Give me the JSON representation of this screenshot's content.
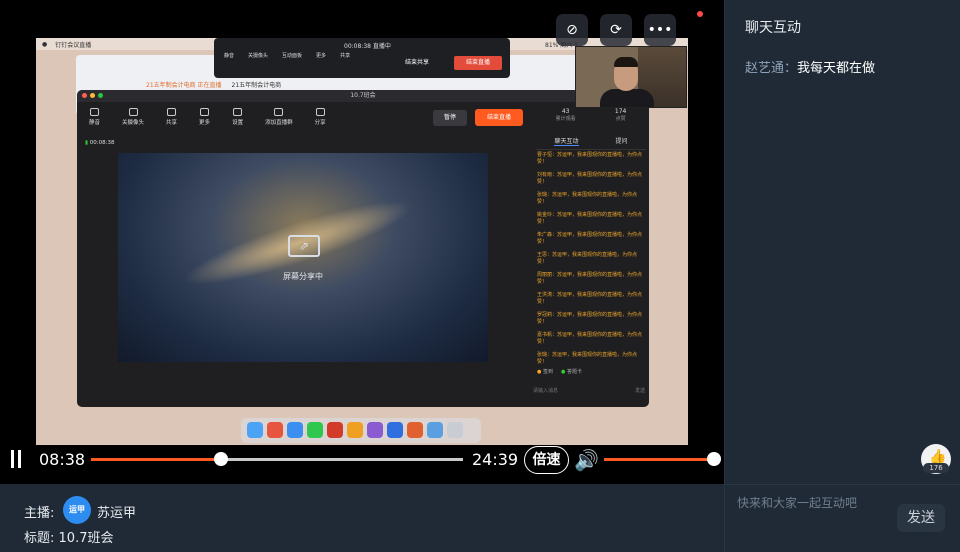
{
  "top_icons": [
    {
      "name": "chat-toggle-icon",
      "glyph": "⊘"
    },
    {
      "name": "rotate-icon",
      "glyph": "⟳"
    },
    {
      "name": "more-icon",
      "glyph": "•••"
    }
  ],
  "screen": {
    "mac_menu_app": "钉钉会议直播",
    "mac_menu_right": "81% 周六 1",
    "back_tabs": [
      "21五年制会计电商 正在直播",
      "21五年制会计电商"
    ],
    "control_bar": {
      "timer": "00:08:38",
      "live_label": "直播中",
      "items": [
        "静音",
        "关摄像头",
        "互动面板",
        "更多",
        "共享"
      ],
      "end_share": "结束共享",
      "end_live": "结束直播"
    },
    "window": {
      "title": "10.7班会",
      "tools": [
        "静音",
        "关摄像头",
        "共享",
        "更多",
        "设置",
        "添加直播群",
        "分享"
      ],
      "pause": "暂停",
      "end_live": "结束直播",
      "rec_time": "00:08:38",
      "share_text": "屏幕分享中",
      "stats": [
        {
          "value": "43",
          "label": "累计观看"
        },
        {
          "value": "174",
          "label": "点赞"
        }
      ],
      "chat_tabs": [
        "聊天互动",
        "提问"
      ],
      "chat_lines": [
        "曹子恒：苏运甲，我来围观你的直播啦，为你点赞！",
        "刘有雨：苏运甲，我来围观你的直播啦，为你点赞！",
        "张璐：苏运甲，我来围观你的直播啦，为你点赞！",
        "姚金玲：苏运甲，我来围观你的直播啦，为你点赞！",
        "朱广森：苏运甲，我来围观你的直播啦，为你点赞！",
        "王思：苏运甲，我来围观你的直播啦，为你点赞！",
        "周丽丽：苏运甲，我来围观你的直播啦，为你点赞！",
        "王洪涛：苏运甲，我来围观你的直播啦，为你点赞！",
        "罗冠莉：苏运甲，我来围观你的直播啦，为你点赞！",
        "嘉书帆：苏运甲，我来围观你的直播啦，为你点赞！",
        "张璐：苏运甲，我来围观你的直播啦，为你点赞！"
      ],
      "chat_bottom": [
        "签到",
        "答题卡"
      ],
      "chat_input_placeholder": "请输入消息",
      "chat_send": "发送"
    }
  },
  "player": {
    "current_time": "08:38",
    "total_time": "24:39",
    "progress": 0.35,
    "speed_label": "倍速",
    "volume": 1.0
  },
  "info": {
    "host_label": "主播:",
    "host_avatar_text": "运甲",
    "host_name": "苏运甲",
    "topic_label": "标题:",
    "topic": "10.7班会"
  },
  "sidebar": {
    "title": "聊天互动",
    "messages": [
      {
        "user": "赵艺通：",
        "text": "我每天都在做"
      }
    ],
    "like_count": "176",
    "input_placeholder": "快来和大家一起互动吧",
    "send_label": "发送"
  },
  "colors": {
    "accent": "#ff5a1f",
    "brand_blue": "#2d8cf0",
    "panel_bg": "#1f2a36"
  }
}
